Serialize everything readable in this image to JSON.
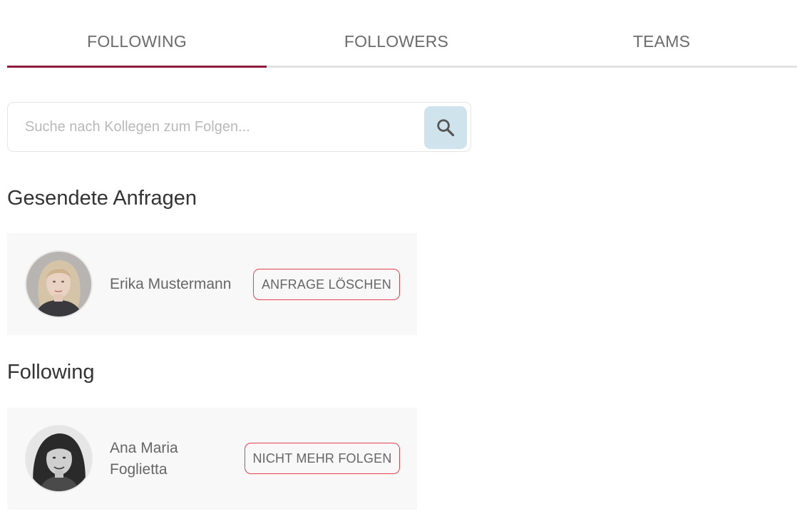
{
  "tabs": [
    {
      "label": "FOLLOWING",
      "active": true
    },
    {
      "label": "FOLLOWERS",
      "active": false
    },
    {
      "label": "TEAMS",
      "active": false
    }
  ],
  "search": {
    "placeholder": "Suche nach Kollegen zum Folgen...",
    "value": "",
    "icon": "search-icon"
  },
  "sections": {
    "sent_requests": {
      "title": "Gesendete Anfragen",
      "people": [
        {
          "name": "Erika Mustermann",
          "action_label": "ANFRAGE LÖSCHEN"
        }
      ]
    },
    "following": {
      "title": "Following",
      "people": [
        {
          "name": "Ana Maria Foglietta",
          "action_label": "NICHT MEHR FOLGEN"
        }
      ]
    }
  },
  "colors": {
    "active_tab_underline": "#8e1a3d",
    "inactive_tab_underline": "#e2e2e2",
    "search_button_bg": "#cfe3ec",
    "action_button_border": "#e0454e",
    "card_bg": "#f8f8f8"
  }
}
